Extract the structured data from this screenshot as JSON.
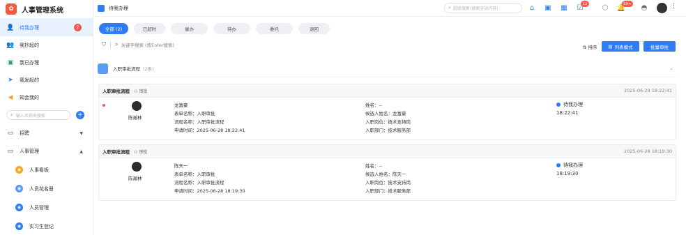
{
  "brand": {
    "title": "人事管理系统"
  },
  "sidebar": {
    "items": [
      {
        "label": "待我办理",
        "badge": "2"
      },
      {
        "label": "我抄起的"
      },
      {
        "label": "我已办理"
      },
      {
        "label": "我发起的"
      },
      {
        "label": "知会我的"
      }
    ],
    "search_placeholder": "输入名称来搜索",
    "groups": [
      {
        "label": "招聘"
      },
      {
        "label": "人事管理"
      }
    ],
    "sub_items": [
      {
        "label": "人事看板"
      },
      {
        "label": "人员花名册"
      },
      {
        "label": "人员管理"
      },
      {
        "label": "实习生登记"
      }
    ]
  },
  "header": {
    "page_title": "待我办理",
    "search_placeholder": "超级搜索(搜索全站内容)",
    "badges": {
      "todo": "12",
      "notify": "99+"
    }
  },
  "tabs": [
    {
      "label": "全部 (2)"
    },
    {
      "label": "已超时"
    },
    {
      "label": "催办"
    },
    {
      "label": "待办"
    },
    {
      "label": "委托"
    },
    {
      "label": "退回"
    }
  ],
  "toolbar": {
    "search_placeholder": "关键字搜索 (按Enter搜索)",
    "sort_label": "排序",
    "list_mode_label": "列表模式",
    "batch_label": "批量审批"
  },
  "group": {
    "title": "入职审批流程",
    "count": "(2条)"
  },
  "cards": [
    {
      "title": "入职审批流程",
      "tag": "审批",
      "time": "2025-06-28 18:22:41",
      "person": "陈瀚林",
      "line1": "龙富豪",
      "form_name": "表单名称：入职审批",
      "flow_name": "流程名称：入职审批流程",
      "apply_time": "申请时间：2025-06-28 18:22:41",
      "name": "姓名：--",
      "candidate": "候选人姓名：龙富豪",
      "post": "入职岗位：技术支持岗",
      "dept": "入职部门：技术服务部",
      "status": "待我办理",
      "status_time": "18:22:41"
    },
    {
      "title": "入职审批流程",
      "tag": "审批",
      "time": "2025-06-28 18:19:30",
      "person": "陈瀚林",
      "line1": "陈天一",
      "form_name": "表单名称：入职审批",
      "flow_name": "流程名称：入职审批流程",
      "apply_time": "申请时间：2025-06-28 18:19:30",
      "name": "姓名：--",
      "candidate": "候选人姓名：陈天一",
      "post": "入职岗位：技术支持岗",
      "dept": "入职部门：技术服务部",
      "status": "待我办理",
      "status_time": "18:19:30"
    }
  ],
  "colors": {
    "accent": "#2f7cf6",
    "badge": "#f5584a",
    "brand": "#f05a3c"
  }
}
